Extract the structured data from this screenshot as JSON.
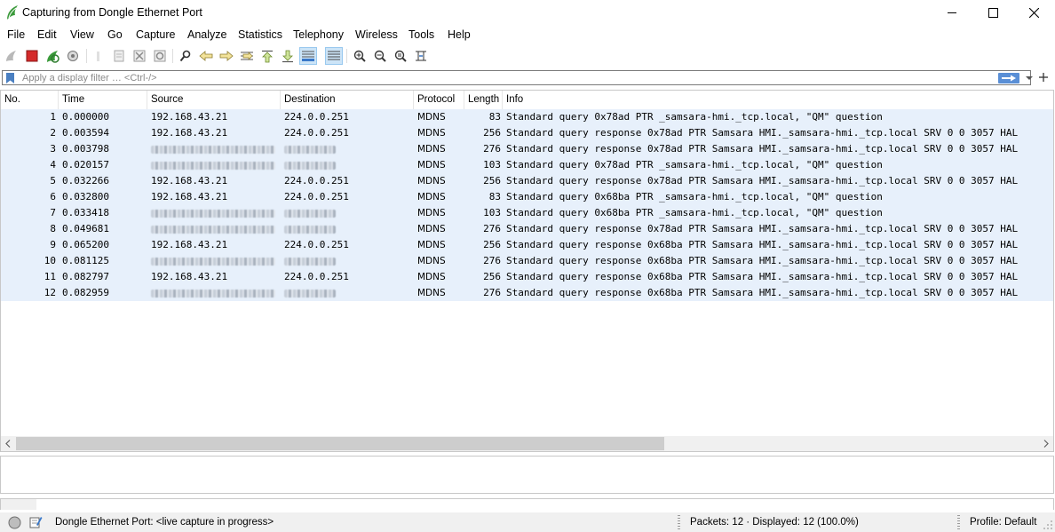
{
  "window": {
    "title": "Capturing from Dongle Ethernet Port",
    "app_icon": "wireshark-fin-icon",
    "controls": [
      "minimize-icon",
      "maximize-icon",
      "close-icon"
    ]
  },
  "menu": [
    "File",
    "Edit",
    "View",
    "Go",
    "Capture",
    "Analyze",
    "Statistics",
    "Telephony",
    "Wireless",
    "Tools",
    "Help"
  ],
  "toolbar": {
    "icons": [
      "start-capture-icon",
      "stop-capture-icon",
      "restart-capture-icon",
      "capture-options-icon",
      "open-file-icon",
      "save-file-icon",
      "close-file-icon",
      "reload-file-icon",
      "find-packet-icon",
      "go-back-icon",
      "go-forward-icon",
      "go-to-packet-icon",
      "first-packet-icon",
      "last-packet-icon",
      "auto-scroll-icon",
      "colorize-icon",
      "zoom-in-icon",
      "zoom-out-icon",
      "zoom-normal-icon",
      "resize-columns-icon"
    ]
  },
  "filter": {
    "placeholder": "Apply a display filter … <Ctrl-/>",
    "value": ""
  },
  "columns": [
    "No.",
    "Time",
    "Source",
    "Destination",
    "Protocol",
    "Length",
    "Info"
  ],
  "packets": [
    {
      "no": "1",
      "time": "0.000000",
      "source": "192.168.43.21",
      "destination": "224.0.0.251",
      "protocol": "MDNS",
      "length": "83",
      "info": "Standard query 0x78ad PTR _samsara-hmi._tcp.local, \"QM\" question"
    },
    {
      "no": "2",
      "time": "0.003594",
      "source": "192.168.43.21",
      "destination": "224.0.0.251",
      "protocol": "MDNS",
      "length": "256",
      "info": "Standard query response 0x78ad PTR Samsara HMI._samsara-hmi._tcp.local SRV 0 0 3057 HAL"
    },
    {
      "no": "3",
      "time": "0.003798",
      "source": "",
      "destination": "",
      "protocol": "MDNS",
      "length": "276",
      "info": "Standard query response 0x78ad PTR Samsara HMI._samsara-hmi._tcp.local SRV 0 0 3057 HAL"
    },
    {
      "no": "4",
      "time": "0.020157",
      "source": "",
      "destination": "",
      "protocol": "MDNS",
      "length": "103",
      "info": "Standard query 0x78ad PTR _samsara-hmi._tcp.local, \"QM\" question"
    },
    {
      "no": "5",
      "time": "0.032266",
      "source": "192.168.43.21",
      "destination": "224.0.0.251",
      "protocol": "MDNS",
      "length": "256",
      "info": "Standard query response 0x78ad PTR Samsara HMI._samsara-hmi._tcp.local SRV 0 0 3057 HAL"
    },
    {
      "no": "6",
      "time": "0.032800",
      "source": "192.168.43.21",
      "destination": "224.0.0.251",
      "protocol": "MDNS",
      "length": "83",
      "info": "Standard query 0x68ba PTR _samsara-hmi._tcp.local, \"QM\" question"
    },
    {
      "no": "7",
      "time": "0.033418",
      "source": "",
      "destination": "",
      "protocol": "MDNS",
      "length": "103",
      "info": "Standard query 0x68ba PTR _samsara-hmi._tcp.local, \"QM\" question"
    },
    {
      "no": "8",
      "time": "0.049681",
      "source": "",
      "destination": "",
      "protocol": "MDNS",
      "length": "276",
      "info": "Standard query response 0x78ad PTR Samsara HMI._samsara-hmi._tcp.local SRV 0 0 3057 HAL"
    },
    {
      "no": "9",
      "time": "0.065200",
      "source": "192.168.43.21",
      "destination": "224.0.0.251",
      "protocol": "MDNS",
      "length": "256",
      "info": "Standard query response 0x68ba PTR Samsara HMI._samsara-hmi._tcp.local SRV 0 0 3057 HAL"
    },
    {
      "no": "10",
      "time": "0.081125",
      "source": "",
      "destination": "",
      "protocol": "MDNS",
      "length": "276",
      "info": "Standard query response 0x68ba PTR Samsara HMI._samsara-hmi._tcp.local SRV 0 0 3057 HAL"
    },
    {
      "no": "11",
      "time": "0.082797",
      "source": "192.168.43.21",
      "destination": "224.0.0.251",
      "protocol": "MDNS",
      "length": "256",
      "info": "Standard query response 0x68ba PTR Samsara HMI._samsara-hmi._tcp.local SRV 0 0 3057 HAL"
    },
    {
      "no": "12",
      "time": "0.082959",
      "source": "",
      "destination": "",
      "protocol": "MDNS",
      "length": "276",
      "info": "Standard query response 0x68ba PTR Samsara HMI._samsara-hmi._tcp.local SRV 0 0 3057 HAL"
    }
  ],
  "row_color": "#e7f0fb",
  "status": {
    "capture_status": "Dongle Ethernet Port: <live capture in progress>",
    "packets": "Packets: 12 · Displayed: 12 (100.0%)",
    "profile": "Profile: Default"
  }
}
